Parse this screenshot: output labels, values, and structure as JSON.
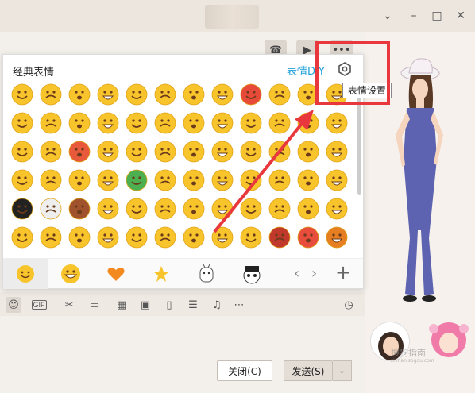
{
  "window": {
    "minimize_icon": "chevron-down",
    "min_icon": "minimize",
    "max_icon": "maximize",
    "close_icon": "close"
  },
  "emoji_panel": {
    "title": "经典表情",
    "diy_label": "表情DIY",
    "settings_tooltip": "表情设置",
    "categories": [
      "smile",
      "smile-big",
      "heart",
      "star",
      "custom-1",
      "custom-2"
    ]
  },
  "toolbar": {
    "gif_label": "GIF"
  },
  "buttons": {
    "close_label": "关闭(C)",
    "send_label": "发送(S)"
  },
  "watermark": {
    "text": "搜狗指南",
    "sub": "zhinan.sogou.com"
  },
  "colors": {
    "accent_blue": "#1e9fd8",
    "annotation_red": "#e8383d",
    "emoji_yellow": "#f7c52b"
  }
}
